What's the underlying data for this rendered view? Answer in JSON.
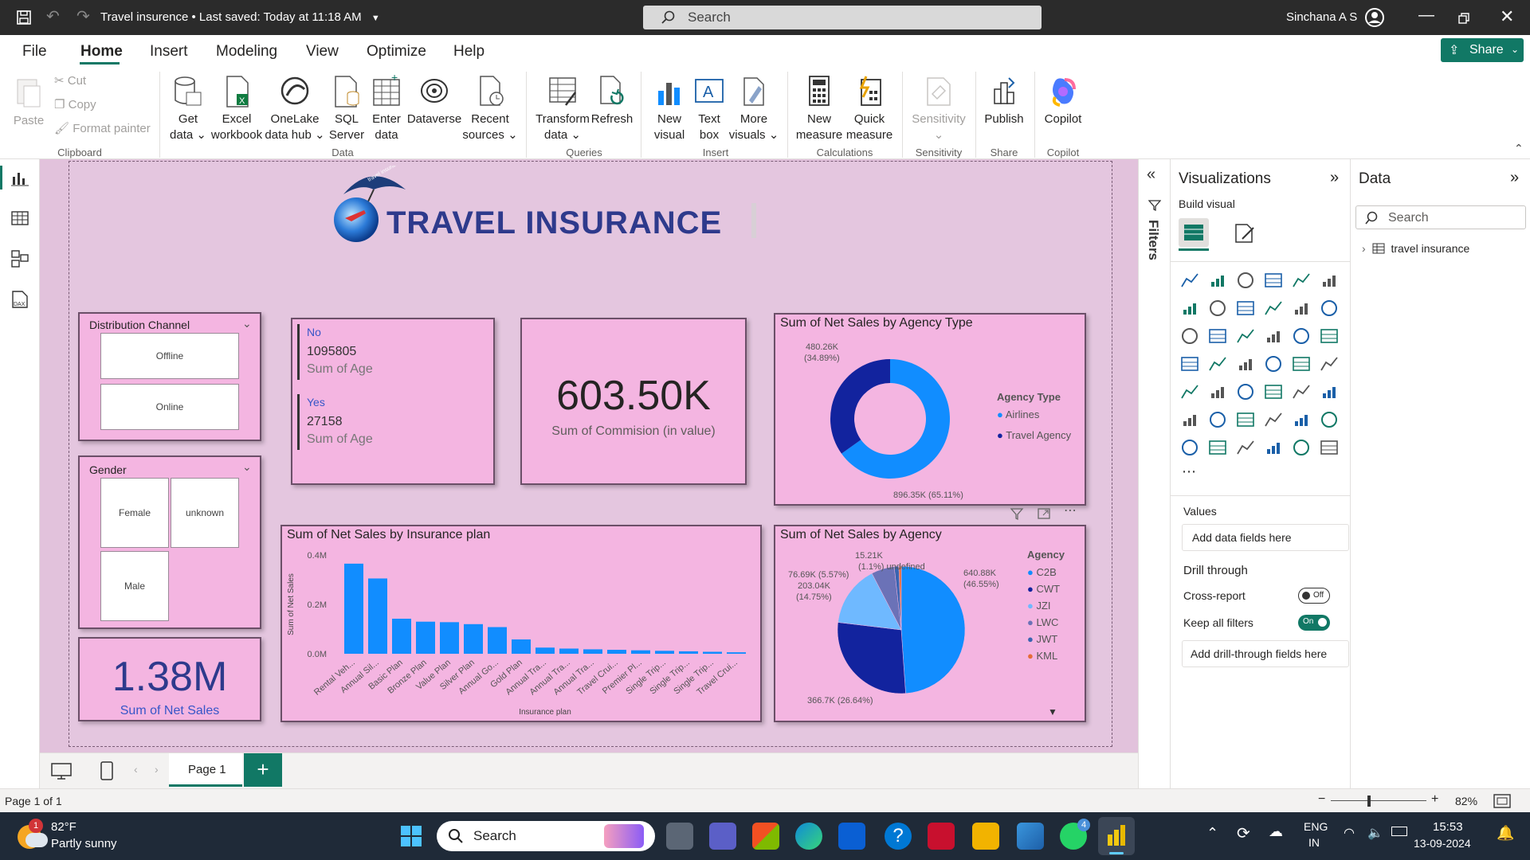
{
  "titlebar": {
    "doc_title": "Travel insurence",
    "saved": "Last saved: Today at 11:18 AM",
    "search_placeholder": "Search",
    "user": "Sinchana A S"
  },
  "menu": {
    "tabs": [
      "File",
      "Home",
      "Insert",
      "Modeling",
      "View",
      "Optimize",
      "Help"
    ],
    "share": "Share"
  },
  "ribbon": {
    "clipboard": {
      "paste": "Paste",
      "cut": "Cut",
      "copy": "Copy",
      "format_painter": "Format painter",
      "group": "Clipboard"
    },
    "data": {
      "get_data": [
        "Get",
        "data"
      ],
      "excel": [
        "Excel",
        "workbook"
      ],
      "onelake": [
        "OneLake",
        "data hub"
      ],
      "sql": [
        "SQL",
        "Server"
      ],
      "enter": [
        "Enter",
        "data"
      ],
      "dataverse": "Dataverse",
      "recent": [
        "Recent",
        "sources"
      ],
      "group": "Data"
    },
    "queries": {
      "transform": [
        "Transform",
        "data"
      ],
      "refresh": "Refresh",
      "group": "Queries"
    },
    "insert": {
      "new_visual": [
        "New",
        "visual"
      ],
      "text_box": [
        "Text",
        "box"
      ],
      "more_visuals": [
        "More",
        "visuals"
      ],
      "group": "Insert"
    },
    "calculations": {
      "new_measure": [
        "New",
        "measure"
      ],
      "quick_measure": [
        "Quick",
        "measure"
      ],
      "group": "Calculations"
    },
    "sensitivity": {
      "label": "Sensitivity",
      "group": "Sensitivity"
    },
    "share": {
      "publish": "Publish",
      "group": "Share"
    },
    "copilot": {
      "label": "Copilot",
      "group": "Copilot"
    }
  },
  "report": {
    "title": "TRAVEL INSURANCE",
    "logo_text": "travel insurance",
    "slicer_channel": {
      "title": "Distribution Channel",
      "items": [
        "Offline",
        "Online"
      ]
    },
    "slicer_gender": {
      "title": "Gender",
      "items": [
        "Female",
        "unknown",
        "Male"
      ]
    },
    "multirow": {
      "rows": [
        {
          "label": "No",
          "value": "1095805",
          "measure": "Sum of Age"
        },
        {
          "label": "Yes",
          "value": "27158",
          "measure": "Sum of Age"
        }
      ]
    },
    "card_commission": {
      "value": "603.50K",
      "label": "Sum of Commision (in value)"
    },
    "card_net_sales": {
      "value": "1.38M",
      "label": "Sum of Net Sales"
    }
  },
  "chart_data": [
    {
      "type": "pie",
      "variant": "donut",
      "title": "Sum of Net Sales by Agency Type",
      "legend_title": "Agency Type",
      "legend_position": "right",
      "categories": [
        "Airlines",
        "Travel Agency"
      ],
      "values": [
        896350,
        480260
      ],
      "labels": [
        "896.35K (65.11%)",
        "480.26K (34.89%)"
      ],
      "colors": [
        "#118dff",
        "#12239e"
      ]
    },
    {
      "type": "bar",
      "title": "Sum of Net Sales by Insurance plan",
      "xlabel": "Insurance plan",
      "ylabel": "Sum of Net Sales",
      "yticks": [
        "0.0M",
        "0.2M",
        "0.4M"
      ],
      "ylim": [
        0,
        0.4
      ],
      "categories": [
        "Rental Veh...",
        "Annual Sil...",
        "Basic Plan",
        "Bronze Plan",
        "Value Plan",
        "Silver Plan",
        "Annual Go...",
        "Gold Plan",
        "Annual Tra...",
        "Annual Tra...",
        "Annual Tra...",
        "Travel Crui...",
        "Premier Pl...",
        "Single Trip...",
        "Single Trip...",
        "Single Trip...",
        "Travel Crui..."
      ],
      "values": [
        0.365,
        0.305,
        0.142,
        0.13,
        0.128,
        0.12,
        0.108,
        0.058,
        0.025,
        0.021,
        0.018,
        0.016,
        0.014,
        0.012,
        0.01,
        0.008,
        0.006
      ],
      "color": "#118dff"
    },
    {
      "type": "pie",
      "title": "Sum of Net Sales by Agency",
      "legend_title": "Agency",
      "legend_position": "right",
      "categories": [
        "C2B",
        "CWT",
        "JZI",
        "LWC",
        "JWT",
        "KML"
      ],
      "values": [
        640880,
        366700,
        203040,
        76690,
        15210,
        8000
      ],
      "labels": [
        "640.88K (46.55%)",
        "366.7K (26.64%)",
        "203.04K (14.75%)",
        "76.69K (5.57%)",
        "15.21K (1.1%)",
        ""
      ],
      "colors": [
        "#118dff",
        "#12239e",
        "#6fb9ff",
        "#6b72b7",
        "#3a64b0",
        "#e66c37"
      ]
    }
  ],
  "panes": {
    "filters": "Filters",
    "viz": {
      "title": "Visualizations",
      "build": "Build visual",
      "values": "Values",
      "add_values": "Add data fields here",
      "drill": "Drill through",
      "cross": "Cross-report",
      "cross_state": "Off",
      "keep": "Keep all filters",
      "keep_state": "On",
      "add_drill": "Add drill-through fields here"
    },
    "data": {
      "title": "Data",
      "search": "Search",
      "table": "travel insurance"
    }
  },
  "pages": {
    "tab": "Page 1",
    "status": "Page 1 of 1",
    "zoom": "82%"
  },
  "taskbar": {
    "temp": "82°F",
    "weather": "Partly sunny",
    "search": "Search",
    "lang1": "ENG",
    "lang2": "IN",
    "time": "15:53",
    "date": "13-09-2024",
    "badge_weather": "1",
    "badge_whatsapp": "4"
  }
}
